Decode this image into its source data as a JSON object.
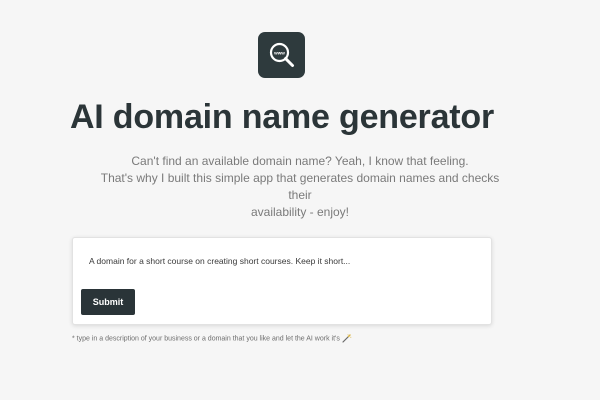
{
  "logo": {
    "icon": "magnifier-www-icon",
    "text": "www",
    "bg_color": "#2e3a3d"
  },
  "header": {
    "title": "AI domain name generator"
  },
  "intro": {
    "line1": "Can't find an available domain name? Yeah, I know that feeling.",
    "line2": "That's why I built this simple app that generates domain names and checks their",
    "line3": "availability - enjoy!"
  },
  "form": {
    "input_value": "A domain for a short course on creating short courses. Keep it short...",
    "submit_label": "Submit",
    "button_color": "#2a3438"
  },
  "footer": {
    "hint": "* type in a description of your business or a domain that you like and let the AI work it's",
    "hint_icon": "magic-wand-icon"
  }
}
